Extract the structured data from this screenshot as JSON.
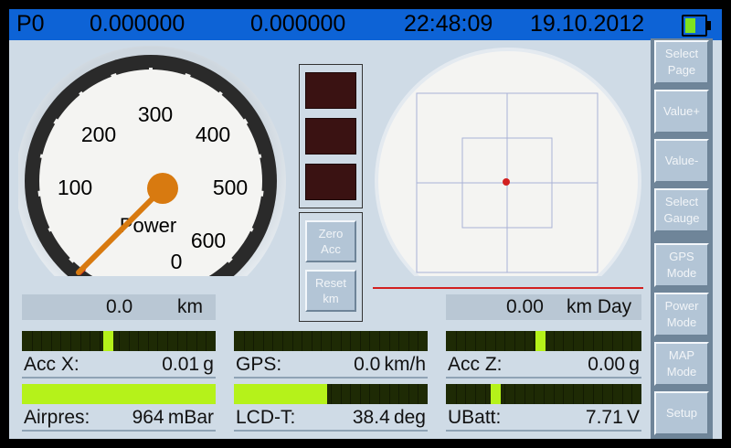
{
  "status_bar": {
    "page": "P0",
    "value1": "0.000000",
    "value2": "0.000000",
    "time": "22:48:09",
    "date": "19.10.2012"
  },
  "gauge": {
    "label": "Power",
    "ticks": [
      "0",
      "100",
      "200",
      "300",
      "400",
      "500",
      "600"
    ],
    "value": 0
  },
  "middle": {
    "zero_acc": [
      "Zero",
      "Acc"
    ],
    "reset_km": [
      "Reset",
      "km"
    ]
  },
  "readouts": {
    "trip_value": "0.0",
    "trip_unit": "km",
    "day_value": "0.00",
    "day_unit": "km Day"
  },
  "meters": [
    {
      "label": "Acc X:",
      "value": "0.01",
      "unit": "g",
      "fill_start": 0.42,
      "fill_end": 0.47,
      "color": "#b5f21a"
    },
    {
      "label": "GPS:",
      "value": "0.0",
      "unit": "km/h",
      "fill_start": 0,
      "fill_end": 0,
      "color": "#b5f21a"
    },
    {
      "label": "Acc Z:",
      "value": "0.00",
      "unit": "g",
      "fill_start": 0.46,
      "fill_end": 0.51,
      "color": "#b5f21a"
    },
    {
      "label": "Airpres:",
      "value": "964",
      "unit": "mBar",
      "fill_start": 0,
      "fill_end": 1.0,
      "color": "#b5f21a"
    },
    {
      "label": "LCD-T:",
      "value": "38.4",
      "unit": "deg",
      "fill_start": 0,
      "fill_end": 0.48,
      "color": "#b5f21a"
    },
    {
      "label": "UBatt:",
      "value": "7.71",
      "unit": "V",
      "fill_start": 0.23,
      "fill_end": 0.28,
      "color": "#b5f21a"
    }
  ],
  "side_buttons": [
    [
      "Select",
      "Page"
    ],
    [
      "Value+"
    ],
    [
      "Value-"
    ],
    [
      "Select",
      "Gauge"
    ],
    [
      "GPS",
      "Mode"
    ],
    [
      "Power",
      "Mode"
    ],
    [
      "MAP",
      "Mode"
    ],
    [
      "Setup"
    ]
  ],
  "colors": {
    "accent": "#0d63d6",
    "bar_bg": "#1e2a05",
    "bar_fill": "#b5f21a",
    "needle": "#d87a10",
    "target_dot": "#d22020"
  }
}
